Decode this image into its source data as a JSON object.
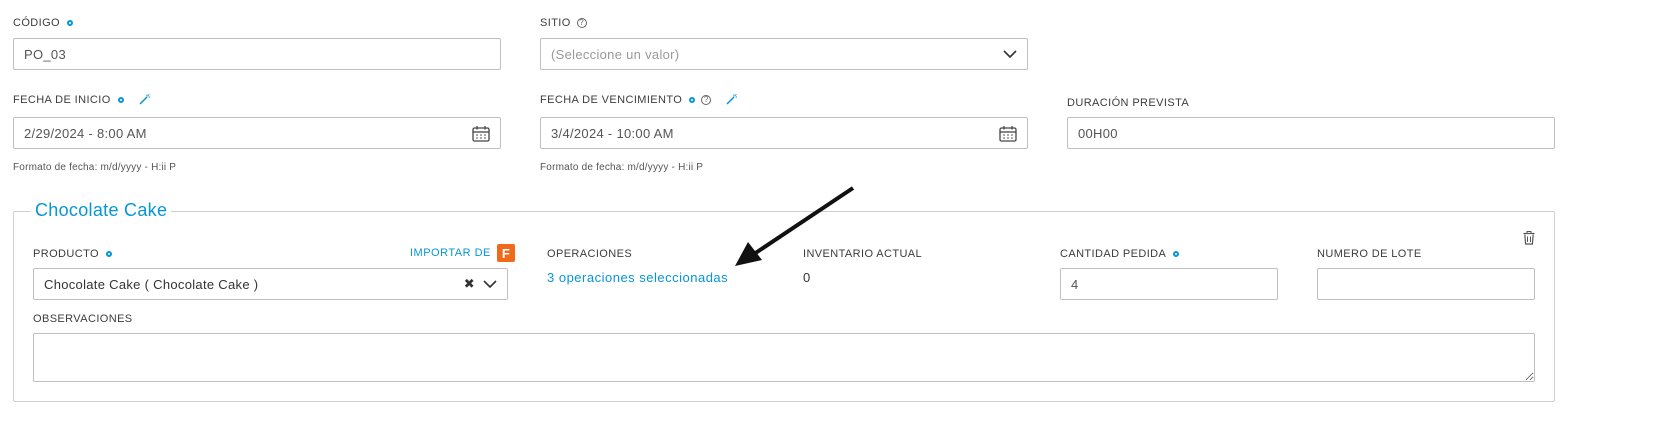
{
  "row1": {
    "codigo": {
      "label": "CÓDIGO",
      "value": "PO_03"
    },
    "sitio": {
      "label": "SITIO",
      "placeholder": "(Seleccione un valor)"
    }
  },
  "row2": {
    "fecha_inicio": {
      "label": "FECHA DE INICIO",
      "value": "2/29/2024 - 8:00 AM",
      "hint": "Formato de fecha: m/d/yyyy - H:ii P"
    },
    "fecha_vencimiento": {
      "label": "FECHA DE VENCIMIENTO",
      "value": "3/4/2024 - 10:00 AM",
      "hint": "Formato de fecha: m/d/yyyy - H:ii P"
    },
    "duracion": {
      "label": "DURACIÓN PREVISTA",
      "value": "00H00"
    }
  },
  "product_section": {
    "title": "Chocolate Cake",
    "producto": {
      "label": "PRODUCTO",
      "value": "Chocolate Cake ( Chocolate Cake )",
      "import_label": "IMPORTAR DE",
      "import_badge": "F"
    },
    "operaciones": {
      "label": "OPERACIONES",
      "link_text": "3 operaciones seleccionadas"
    },
    "inventario": {
      "label": "INVENTARIO ACTUAL",
      "value": "0"
    },
    "cantidad": {
      "label": "CANTIDAD PEDIDA",
      "value": "4"
    },
    "lote": {
      "label": "NUMERO DE LOTE",
      "value": ""
    },
    "observaciones": {
      "label": "OBSERVACIONES",
      "value": ""
    }
  },
  "colors": {
    "accent": "#0696d7",
    "import_badge": "#f06a1b"
  },
  "icons": [
    "required-dot-icon",
    "help-icon",
    "magic-wand-icon",
    "calendar-icon",
    "chevron-down-icon",
    "clear-icon",
    "trash-icon",
    "arrow-annotation"
  ]
}
